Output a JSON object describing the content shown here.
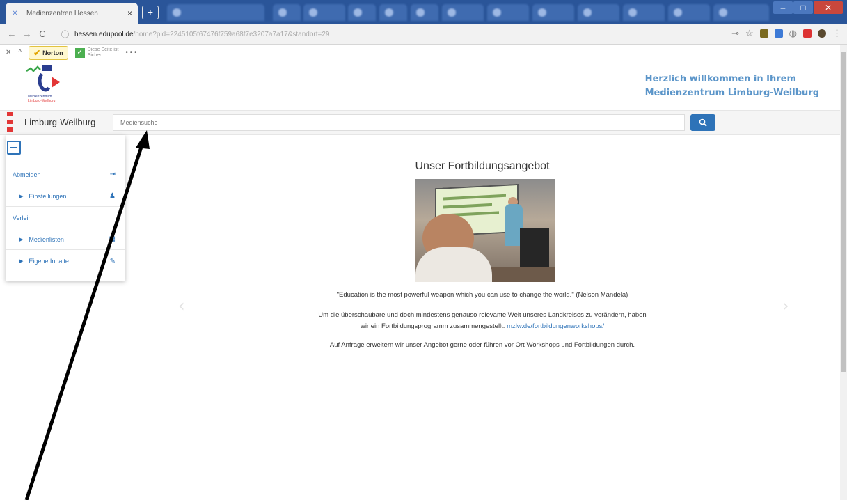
{
  "browser": {
    "active_tab_title": "Medienzentren Hessen",
    "tab_close": "×",
    "new_tab": "+",
    "url_info": "ⓘ",
    "url_host": "hessen.edupool.de",
    "url_path": "/home?pid=2245105f67476f759a68f7e3207a7a17&standort=29",
    "nav_back": "←",
    "nav_forward": "→",
    "nav_reload": "C",
    "menu_dots": "⋮",
    "win_min": "–",
    "win_max": "□",
    "win_close": "✕"
  },
  "extbar": {
    "close": "✕",
    "collapse": "^",
    "norton": "Norton",
    "safe_text_1": "Diese Seite ist",
    "safe_text_2": "Sicher",
    "more": "• • •"
  },
  "header": {
    "logo_caption_1": "Medienzentrum",
    "logo_caption_2": "Limburg-Weilburg",
    "welcome_line1": "Herzlich willkommen in Ihrem",
    "welcome_line2": "Medienzentrum Limburg-Weilburg"
  },
  "search": {
    "region": "Limburg-Weilburg",
    "placeholder": "Mediensuche",
    "button_icon": "search-icon"
  },
  "menu": {
    "items": [
      {
        "label": "Abmelden",
        "icon": "sign-out-icon",
        "icon_glyph": "⇥"
      },
      {
        "label": "Einstellungen",
        "icon": "user-icon",
        "icon_glyph": "♟"
      },
      {
        "label": "Verleih",
        "icon": "",
        "icon_glyph": ""
      },
      {
        "label": "Medienlisten",
        "icon": "list-icon",
        "icon_glyph": "▦"
      },
      {
        "label": "Eigene Inhalte",
        "icon": "edit-icon",
        "icon_glyph": "✎"
      }
    ]
  },
  "content": {
    "title": "Unser Fortbildungsangebot",
    "quote": "\"Education is the most powerful weapon which you can use to change the world.\" (Nelson Mandela)",
    "para_line1": "Um die überschaubare und doch mindestens genauso relevante Welt unseres Landkreises zu verändern, haben",
    "para_line2_text": "wir ein Fortbildungsprogramm zusammengestellt: ",
    "para_link": "mzlw.de/fortbildungenworkshops/",
    "para2": "Auf Anfrage erweitern wir unser Angebot gerne oder führen vor Ort Workshops und Fortbildungen durch.",
    "prev": "‹",
    "next": "›"
  },
  "colors": {
    "accent": "#2e73b8",
    "welcome": "#5b95c9",
    "tabstrip": "#2a5599",
    "brand_red": "#e23636"
  }
}
